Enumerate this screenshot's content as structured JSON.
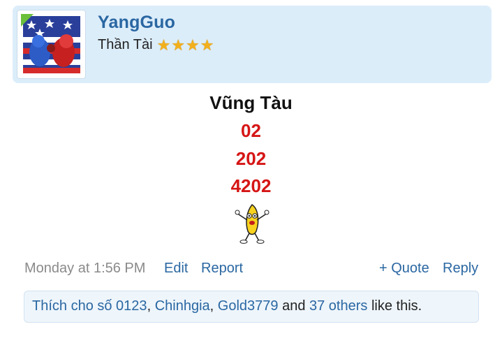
{
  "post": {
    "username": "YangGuo",
    "user_title": "Thần Tài",
    "rank_stars": 4,
    "content": {
      "city": "Vũng Tàu",
      "numbers": [
        "02",
        "202",
        "4202"
      ],
      "emoji": "dancing-banana"
    },
    "timestamp": "Monday at 1:56 PM",
    "actions": {
      "edit": "Edit",
      "report": "Report",
      "quote": "+ Quote",
      "reply": "Reply"
    },
    "likes": {
      "users": [
        "Thích cho số 0123",
        "Chinhgia",
        "Gold3779"
      ],
      "sep": ", ",
      "and": " and ",
      "others": "37 others",
      "suffix": " like this."
    }
  },
  "colors": {
    "header_bg": "#dcedfa",
    "link": "#2a67a2",
    "number": "#d61515",
    "star": "#f2b01e"
  }
}
